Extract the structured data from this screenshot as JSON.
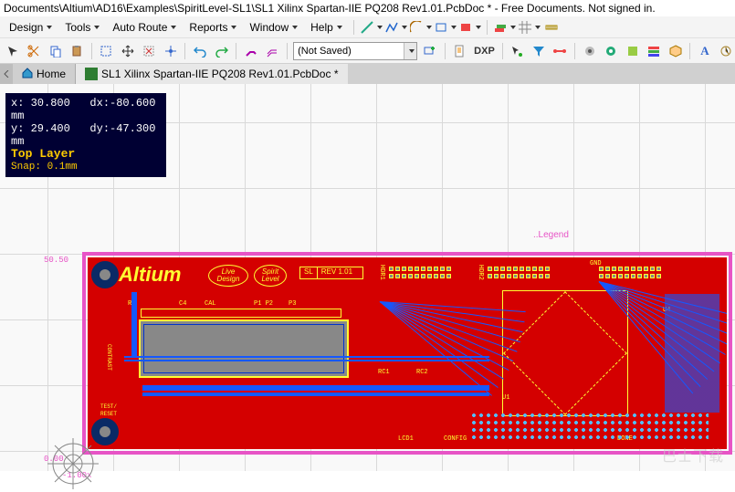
{
  "title": "Documents\\Altium\\AD16\\Examples\\SpiritLevel-SL1\\SL1 Xilinx Spartan-IIE PQ208 Rev1.01.PcbDoc * - Free Documents. Not signed in.",
  "menu": {
    "design": "Design",
    "tools": "Tools",
    "autoroute": "Auto Route",
    "reports": "Reports",
    "window": "Window",
    "help": "Help"
  },
  "toolbar": {
    "notsaved": "(Not Saved)",
    "dxp": "DXP"
  },
  "tabs": {
    "home": "Home",
    "doc": "SL1 Xilinx Spartan-IIE PQ208 Rev1.01.PcbDoc *"
  },
  "hud": {
    "x": "x: 30.800",
    "dx": "dx:-80.600  mm",
    "y": "y: 29.400",
    "dy": "dy:-47.300  mm",
    "layer": "Top Layer",
    "snap": "Snap: 0.1mm"
  },
  "board": {
    "logo": "Altium",
    "oval1a": "Live",
    "oval1b": "Design",
    "oval2a": "Spirit",
    "oval2b": "Level",
    "sl": "SL",
    "rev": "REV 1.01",
    "legend": "..Legend",
    "ruler_top": "50.50",
    "ruler_bot": "0.00",
    "origin_lbl": "-1.00x",
    "refs": {
      "r1": "R1",
      "c4": "C4",
      "c5": "CAL",
      "p1": "P1 P2",
      "p3": "P3",
      "hdr1": "HDR1",
      "hdr2": "HDR2",
      "u1": "U1",
      "u4": "U4",
      "rc1": "RC1",
      "rc2": "RC2",
      "gnd": "GND",
      "contrast": "CONTRAST",
      "test": "TEST/",
      "reset": "RESET",
      "lcd1": "LCD1",
      "done": "DONE",
      "config": "CONFIG"
    }
  },
  "watermark": "巴士下载"
}
